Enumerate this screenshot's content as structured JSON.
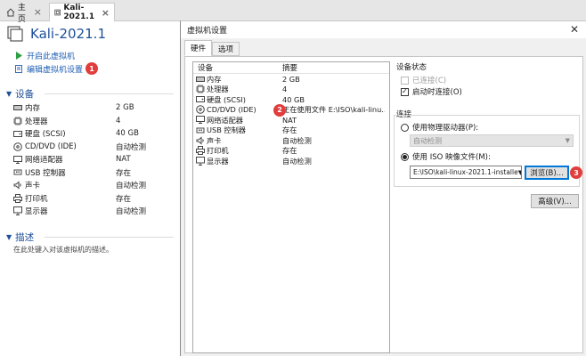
{
  "tabs": [
    {
      "label": "主页",
      "icon": "home-icon"
    },
    {
      "label": "Kali-2021.1",
      "icon": "vm-icon"
    }
  ],
  "vm": {
    "title": "Kali-2021.1",
    "actions": {
      "start": "开启此虚拟机",
      "edit": "编辑虚拟机设置",
      "edit_badge": "1"
    }
  },
  "devices": {
    "heading": "设备",
    "items": [
      {
        "name": "内存",
        "value": "2 GB",
        "icon": "memory-icon"
      },
      {
        "name": "处理器",
        "value": "4",
        "icon": "cpu-icon"
      },
      {
        "name": "硬盘 (SCSI)",
        "value": "40 GB",
        "icon": "hard-disk-icon"
      },
      {
        "name": "CD/DVD (IDE)",
        "value": "自动检测",
        "icon": "cd-dvd-icon"
      },
      {
        "name": "网络适配器",
        "value": "NAT",
        "icon": "network-icon"
      },
      {
        "name": "USB 控制器",
        "value": "存在",
        "icon": "usb-icon"
      },
      {
        "name": "声卡",
        "value": "自动检测",
        "icon": "sound-icon"
      },
      {
        "name": "打印机",
        "value": "存在",
        "icon": "printer-icon"
      },
      {
        "name": "显示器",
        "value": "自动检测",
        "icon": "display-icon"
      }
    ]
  },
  "description": {
    "heading": "描述",
    "placeholder": "在此处键入对该虚拟机的描述。"
  },
  "dialog": {
    "title": "虚拟机设置",
    "tabs": [
      "硬件",
      "选项"
    ],
    "hw_headers": {
      "device": "设备",
      "summary": "摘要"
    },
    "hw_rows": [
      {
        "name": "内存",
        "summary": "2 GB",
        "icon": "memory-icon"
      },
      {
        "name": "处理器",
        "summary": "4",
        "icon": "cpu-icon"
      },
      {
        "name": "硬盘 (SCSI)",
        "summary": "40 GB",
        "icon": "hard-disk-icon"
      },
      {
        "name": "CD/DVD (IDE)",
        "summary": "正在使用文件 E:\\ISO\\kali-linu...",
        "icon": "cd-dvd-icon"
      },
      {
        "name": "网络适配器",
        "summary": "NAT",
        "icon": "network-icon"
      },
      {
        "name": "USB 控制器",
        "summary": "存在",
        "icon": "usb-icon"
      },
      {
        "name": "声卡",
        "summary": "自动检测",
        "icon": "sound-icon"
      },
      {
        "name": "打印机",
        "summary": "存在",
        "icon": "printer-icon"
      },
      {
        "name": "显示器",
        "summary": "自动检测",
        "icon": "display-icon"
      }
    ],
    "cd_badge": "2",
    "device_status": {
      "label": "设备状态",
      "connected": "已连接(C)",
      "connected_checked": false,
      "connect_on_power": "启动时连接(O)",
      "connect_on_power_checked": true
    },
    "connection": {
      "label": "连接",
      "physical": "使用物理驱动器(P):",
      "physical_value": "自动检测",
      "iso": "使用 ISO 映像文件(M):",
      "iso_value": "E:\\ISO\\kali-linux-2021.1-installe",
      "browse": "浏览(B)...",
      "browse_badge": "3"
    },
    "advanced": "高级(V)..."
  }
}
